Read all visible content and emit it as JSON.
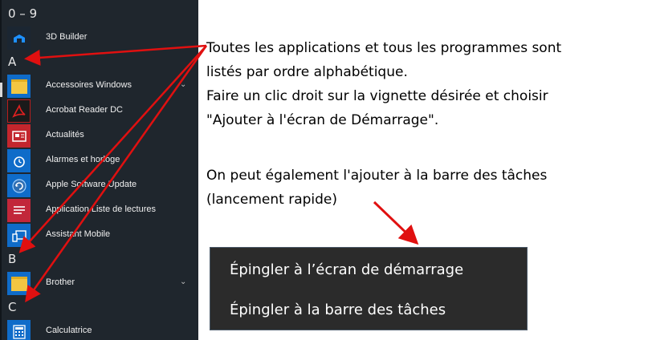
{
  "start_menu": {
    "groups": [
      {
        "header": "0 – 9",
        "apps": [
          {
            "label": "3D Builder",
            "icon": "3d-builder-icon",
            "expandable": false
          }
        ]
      },
      {
        "header": "A",
        "apps": [
          {
            "label": "Accessoires Windows",
            "icon": "folder-icon",
            "expandable": true
          },
          {
            "label": "Acrobat Reader DC",
            "icon": "acrobat-icon",
            "expandable": false
          },
          {
            "label": "Actualités",
            "icon": "news-icon",
            "expandable": false
          },
          {
            "label": "Alarmes et horloge",
            "icon": "alarm-clock-icon",
            "expandable": false
          },
          {
            "label": "Apple Software Update",
            "icon": "apple-update-icon",
            "expandable": false
          },
          {
            "label": "Application Liste de lectures",
            "icon": "reading-list-icon",
            "expandable": false
          },
          {
            "label": "Assistant Mobile",
            "icon": "mobile-assistant-icon",
            "expandable": false
          }
        ]
      },
      {
        "header": "B",
        "apps": [
          {
            "label": "Brother",
            "icon": "folder-icon",
            "expandable": true
          }
        ]
      },
      {
        "header": "C",
        "apps": [
          {
            "label": "Calculatrice",
            "icon": "calculator-icon",
            "expandable": false
          }
        ]
      }
    ],
    "colors": {
      "background": "#1f262d",
      "tile_blue": "#0f6cc9",
      "folder_yellow": "#f3c642",
      "acrobat_red": "#b81d1d",
      "reading_list_red": "#c2273a"
    }
  },
  "annotation": {
    "line1": "Toutes les applications et tous les programmes sont",
    "line2": "listés par ordre alphabétique.",
    "line3": "Faire un clic droit sur la vignette désirée et choisir",
    "line4": "\"Ajouter à l'écran de Démarrage\".",
    "line5": "On peut également l'ajouter à la barre des tâches",
    "line6": "(lancement rapide)"
  },
  "context_menu": {
    "items": [
      "Épingler à l’écran de démarrage",
      "Épingler à la barre des tâches"
    ]
  },
  "arrow_color": "#e01010"
}
